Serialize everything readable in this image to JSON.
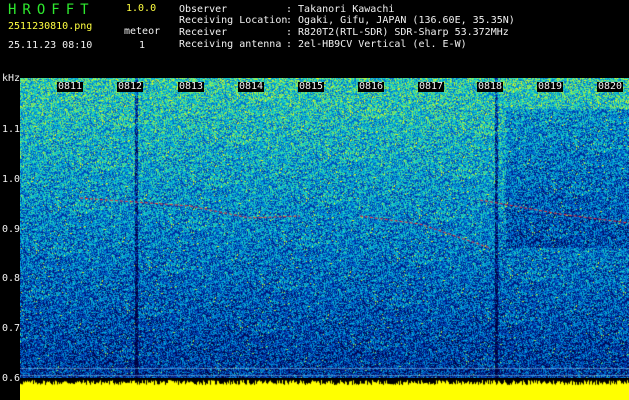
{
  "app": {
    "title": "HROFFT",
    "version": "1.0.0"
  },
  "file": {
    "name": "2511230810.png",
    "timestamp": "25.11.23 08:10"
  },
  "meteor": {
    "label": "meteor",
    "count": "1"
  },
  "info": [
    {
      "label": "Observer",
      "value": ": Takanori Kawachi"
    },
    {
      "label": "Receiving Location",
      "value": ": Ogaki, Gifu, JAPAN (136.60E, 35.35N)"
    },
    {
      "label": "Receiver",
      "value": ": R820T2(RTL-SDR) SDR-Sharp 53.372MHz"
    },
    {
      "label": "Receiving antenna",
      "value": ": 2el-HB9CV Vertical (el. E-W)"
    }
  ],
  "spectrogram": {
    "y_unit": "kHz",
    "y_ticks": [
      "1.1",
      "1.0",
      "0.9",
      "0.8",
      "0.7",
      "0.6"
    ],
    "time_ticks": [
      "0811",
      "0812",
      "0813",
      "0814",
      "0815",
      "0816",
      "0817",
      "0818",
      "0819",
      "0820"
    ],
    "colors": {
      "background": "#000000",
      "axis_text": "#f2f2f2",
      "header_text": "#2ee82e",
      "activity": "#ffff00",
      "trace": "#ff3030"
    }
  }
}
